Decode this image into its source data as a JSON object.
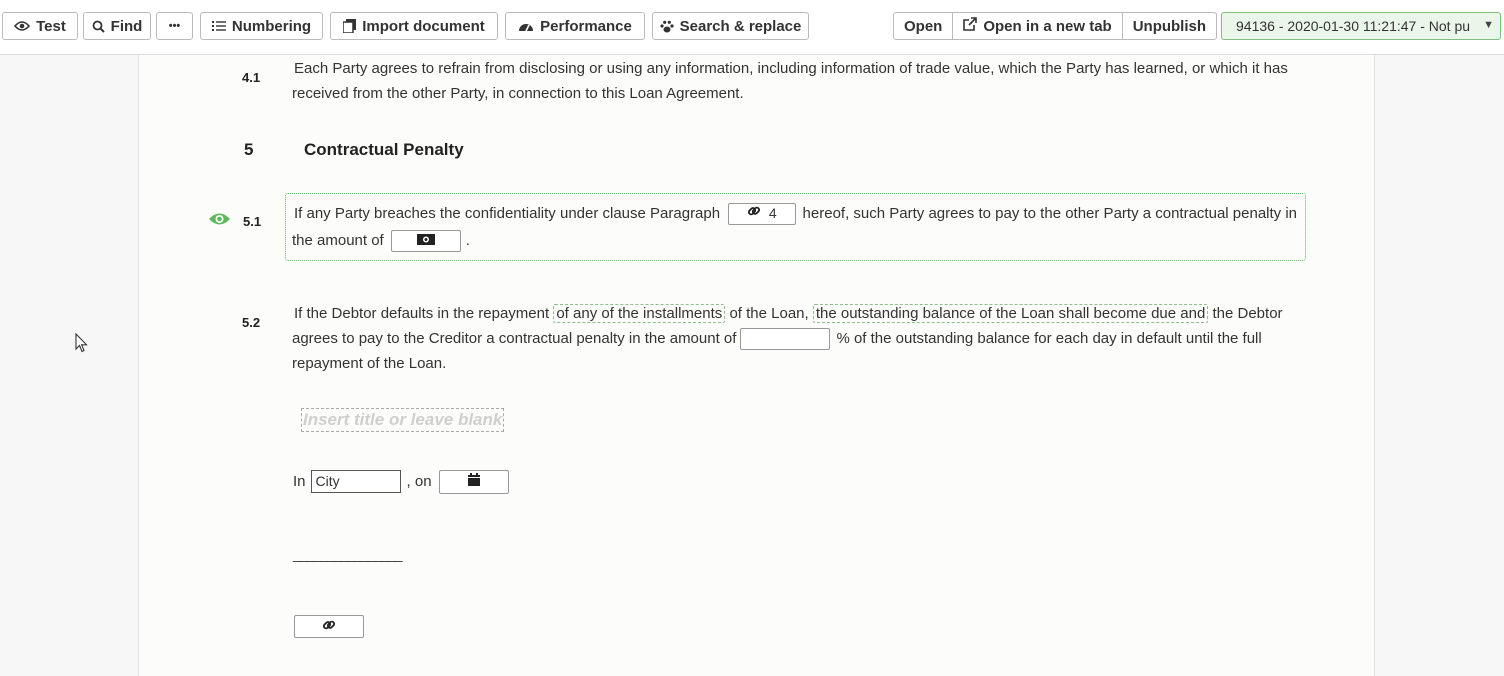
{
  "toolbar": {
    "test_label": "Test",
    "find_label": "Find",
    "more_label": "•••",
    "numbering_label": "Numbering",
    "import_label": "Import document",
    "performance_label": "Performance",
    "search_replace_label": "Search & replace",
    "open_label": "Open",
    "open_new_tab_label": "Open in a new tab",
    "unpublish_label": "Unpublish",
    "version_label": "94136 - 2020-01-30 11:21:47 - Not pu"
  },
  "icons": {
    "test": "eye-icon",
    "find": "search-icon",
    "numbering": "list-icon",
    "import": "document-icon",
    "performance": "gauge-icon",
    "search_replace": "paw-icon",
    "open_new_tab": "external-link-icon",
    "reference": "link-icon",
    "money": "money-icon",
    "date": "calendar-icon",
    "visibility": "eye-icon"
  },
  "colors": {
    "accent_green": "#5cb85c",
    "page_bg": "#fcfcfa",
    "outer_bg": "#f6f7f6"
  },
  "document": {
    "s41": {
      "num": "4.1",
      "line1": "Each Party agrees to refrain from disclosing or using any information, including information of trade value, which the Party has learned, or which it has",
      "line2": "received from the other Party, in connection to this Loan Agreement."
    },
    "s5": {
      "num": "5",
      "title": "Contractual Penalty"
    },
    "s51": {
      "num": "5.1",
      "text_a": "If any Party breaches the confidentiality under clause Paragraph",
      "ref_value": "4",
      "text_b": "hereof, such Party agrees to pay to the other Party a contractual penalty in",
      "text_c": "the amount of",
      "text_d": "."
    },
    "s52": {
      "num": "5.2",
      "text_a": "If the Debtor defaults in the repayment",
      "opt1": "of any of the installments",
      "text_b": "of the Loan,",
      "opt2": "the outstanding balance of the Loan shall become due and",
      "text_c": "the Debtor",
      "text_d": "agrees to pay to the Creditor a contractual penalty in the amount of",
      "text_e": "% of the outstanding balance for each day in default until the full",
      "text_f": "repayment of the Loan."
    },
    "title_placeholder": "Insert title or leave blank",
    "place": {
      "in_label": "In",
      "city_value": "City",
      "on_label": ", on"
    },
    "signature_line": "________________"
  }
}
